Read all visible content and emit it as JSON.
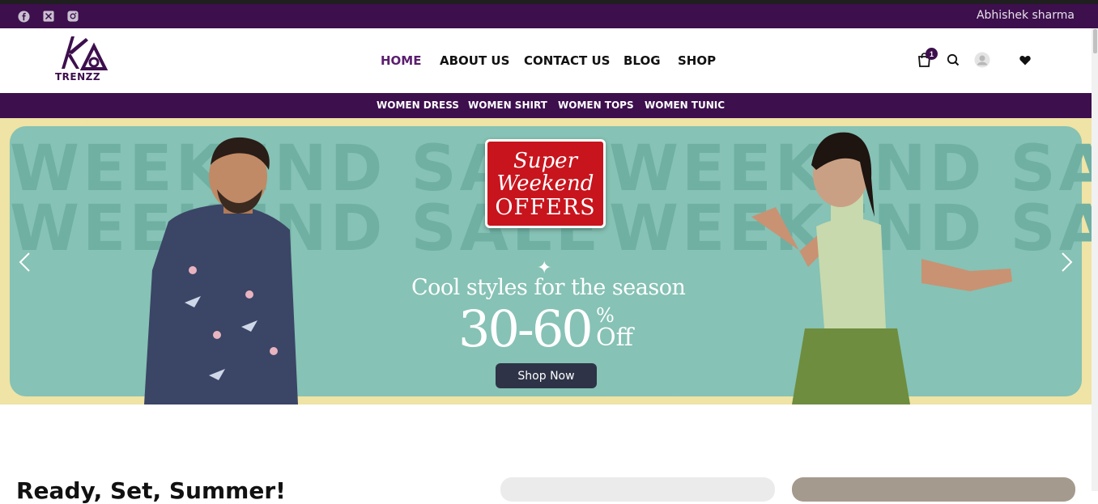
{
  "topbar": {
    "social": [
      "facebook-icon",
      "x-icon",
      "instagram-icon"
    ],
    "user_name": "Abhishek sharma"
  },
  "brand": {
    "logo_text": "TRENZZ"
  },
  "nav": {
    "items": [
      "HOME",
      "ABOUT US",
      "CONTACT US",
      "BLOG",
      "SHOP"
    ],
    "active": "HOME"
  },
  "header_icons": {
    "cart_count": "1"
  },
  "categories": [
    "WOMEN DRESS",
    "WOMEN SHIRT",
    "WOMEN TOPS",
    "WOMEN TUNIC"
  ],
  "hero": {
    "watermark": "WEEKEND SALE",
    "offer_line1": "Super",
    "offer_line2": "Weekend",
    "offer_line3": "OFFERS",
    "tagline": "Cool styles for the season",
    "discount": "30-60",
    "percent": "%",
    "off": "Off",
    "cta": "Shop Now"
  },
  "section": {
    "title": "Ready, Set, Summer!"
  },
  "colors": {
    "brand_purple": "#3d0f4d",
    "hero_teal": "#86c2b5",
    "hero_cream": "#efe3a5",
    "offer_red": "#c8141d",
    "cta_dark": "#2e3347"
  }
}
